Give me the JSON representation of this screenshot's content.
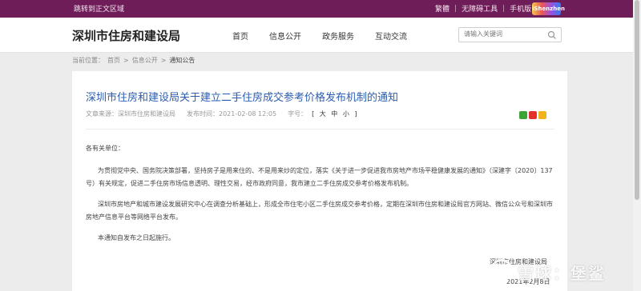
{
  "topbar": {
    "skip": "跳转到正文区域",
    "links": [
      "繁體",
      "无障碍工具",
      "手机版"
    ],
    "badge": "iShenzhen"
  },
  "header": {
    "site_title": "深圳市住房和建设局",
    "nav": [
      "首页",
      "信息公开",
      "政务服务",
      "互动交流"
    ],
    "search_placeholder": "请输入关键词"
  },
  "breadcrumb": {
    "label": "当前位置：",
    "items": [
      "首页",
      "信息公开",
      "通知公告"
    ],
    "separator": ">"
  },
  "article": {
    "title": "深圳市住房和建设局关于建立二手住房成交参考价格发布机制的通知",
    "source_label": "文章来源：",
    "source": "深圳市住房和建设局",
    "time_label": "发布时间：",
    "time": "2021-02-08 12:05",
    "size_label": "字号：",
    "size_options": "[ 大 中 小 ]",
    "greeting": "各有关单位：",
    "paragraphs": [
      "为贯彻党中央、国务院决策部署，坚持房子是用来住的、不是用来炒的定位，落实《关于进一步促进我市房地产市场平稳健康发展的通知》（深建字〔2020〕137号）有关规定，促进二手住房市场信息透明、理性交易，经市政府同意，我市建立二手住房成交参考价格发布机制。",
      "深圳市房地产和城市建设发展研究中心在调查分析基础上，形成全市住宅小区二手住房成交参考价格，定期在深圳市住房和建设局官方网站、微信公众号和深圳市房地产信息平台等网络平台发布。",
      "本通知自发布之日起施行。"
    ],
    "signature": "深圳市住房和建设局",
    "date": "2021年2月8日"
  },
  "watermark": "雪球：堡鲨",
  "colors": {
    "topbar": "#6e1d58",
    "title": "#2a5db0"
  }
}
